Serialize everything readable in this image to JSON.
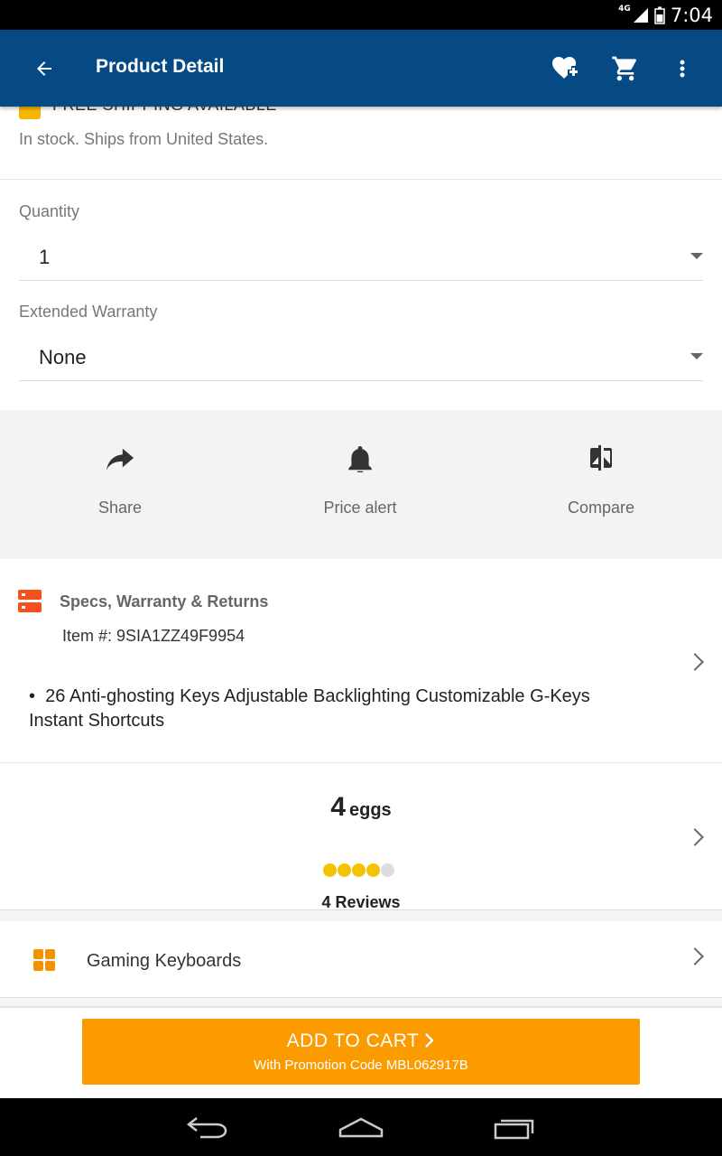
{
  "status_bar": {
    "network": "4G",
    "time": "7:04"
  },
  "app_bar": {
    "title": "Product Detail",
    "back_icon": "arrow-left-icon",
    "wishlist_icon": "heart-plus-icon",
    "cart_icon": "shopping-cart-icon",
    "menu_icon": "more-vert-icon"
  },
  "shipping": {
    "title": "FREE SHIPPING AVAILABLE",
    "subtitle": "In stock. Ships from United States."
  },
  "quantity": {
    "label": "Quantity",
    "value": "1"
  },
  "warranty": {
    "label": "Extended Warranty",
    "value": "None"
  },
  "actions": [
    {
      "label": "Share",
      "icon": "share-icon"
    },
    {
      "label": "Price alert",
      "icon": "bell-icon"
    },
    {
      "label": "Compare",
      "icon": "compare-icon"
    }
  ],
  "specs": {
    "heading": "Specs, Warranty & Returns",
    "item_number": "Item #: 9SIA1ZZ49F9954",
    "bullet": "26 Anti-ghosting Keys Adjustable Backlighting Customizable G-Keys Instant Shortcuts"
  },
  "reviews": {
    "rating": "4",
    "rating_unit": "eggs",
    "eggs_filled": 4,
    "eggs_total": 5,
    "count_label": "4 Reviews",
    "egg_color": "#f5c200"
  },
  "category": {
    "label": "Gaming Keyboards",
    "icon": "grid-icon"
  },
  "cart": {
    "button_label": "ADD TO CART",
    "promo": "With Promotion Code MBL062917B",
    "color": "#fb9b00"
  },
  "colors": {
    "app_bar": "#054a84",
    "accent_orange": "#fb9b00",
    "specs_icon": "#f4511e"
  }
}
